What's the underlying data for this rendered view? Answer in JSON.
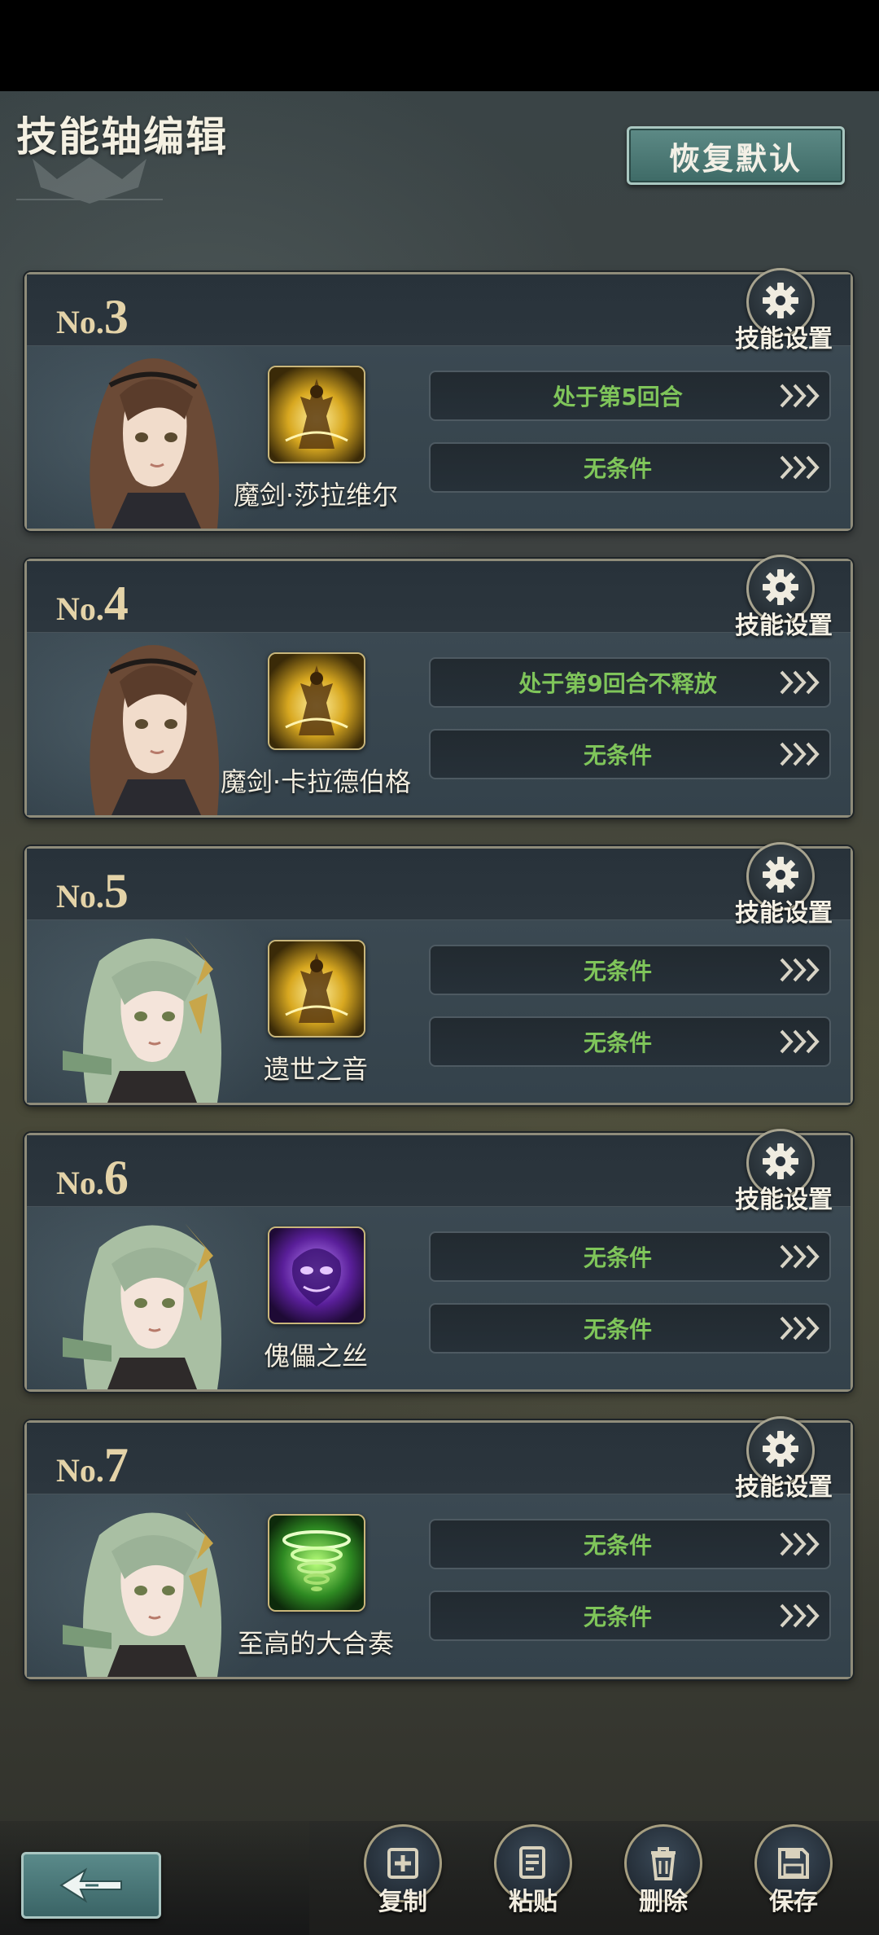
{
  "header": {
    "title": "技能轴编辑",
    "reset_label": "恢复默认"
  },
  "cards": [
    {
      "no_prefix": "No.",
      "number": "3",
      "settings_label": "技能设置",
      "skill_name": "魔剑·莎拉维尔",
      "skill_icon": "golden-warrior-icon",
      "conditions": [
        "处于第5回合",
        "无条件"
      ],
      "character": "brown-hair-swordswoman"
    },
    {
      "no_prefix": "No.",
      "number": "4",
      "settings_label": "技能设置",
      "skill_name": "魔剑·卡拉德伯格",
      "skill_icon": "golden-warrior-icon",
      "conditions": [
        "处于第9回合不释放",
        "无条件"
      ],
      "character": "brown-hair-swordswoman"
    },
    {
      "no_prefix": "No.",
      "number": "5",
      "settings_label": "技能设置",
      "skill_name": "遗世之音",
      "skill_icon": "golden-warrior-icon",
      "conditions": [
        "无条件",
        "无条件"
      ],
      "character": "green-hair-girl"
    },
    {
      "no_prefix": "No.",
      "number": "6",
      "settings_label": "技能设置",
      "skill_name": "傀儡之丝",
      "skill_icon": "purple-spirit-icon",
      "conditions": [
        "无条件",
        "无条件"
      ],
      "character": "green-hair-girl"
    },
    {
      "no_prefix": "No.",
      "number": "7",
      "settings_label": "技能设置",
      "skill_name": "至高的大合奏",
      "skill_icon": "green-tornado-icon",
      "conditions": [
        "无条件",
        "无条件"
      ],
      "character": "green-hair-girl"
    }
  ],
  "toolbar": {
    "back_icon": "back-arrow-icon",
    "copy_label": "复制",
    "paste_label": "粘贴",
    "delete_label": "删除",
    "save_label": "保存"
  },
  "colors": {
    "condition_text": "#7fc55a",
    "number_gold": "#e4d3a8",
    "button_teal": "#4a7a76"
  }
}
